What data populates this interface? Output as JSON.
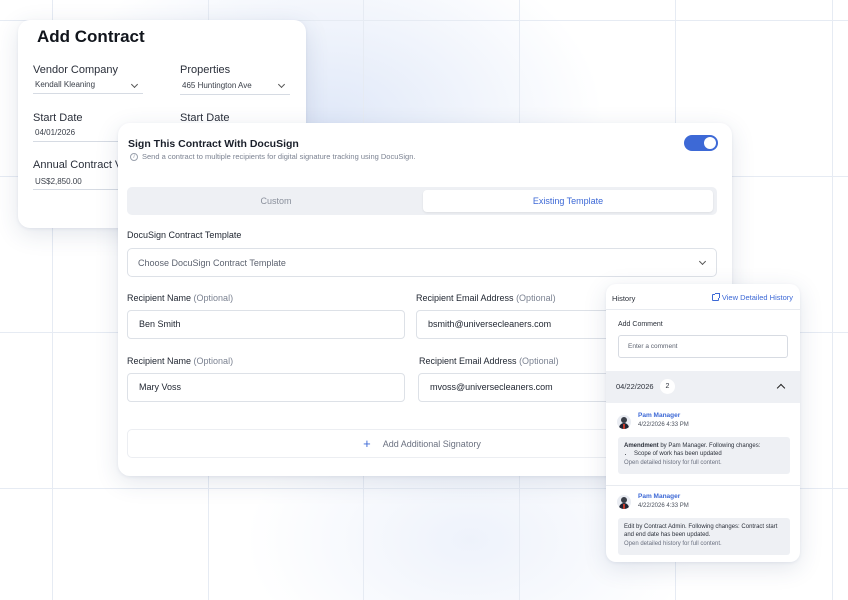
{
  "add_contract": {
    "title": "Add Contract",
    "vendor_label": "Vendor Company",
    "vendor_value": "Kendall Kleaning",
    "properties_label": "Properties",
    "properties_value": "465 Huntington Ave",
    "start_date_label_1": "Start Date",
    "start_date_value_1": "04/01/2026",
    "start_date_label_2": "Start Date",
    "annual_label": "Annual Contract V",
    "annual_value": "US$2,850.00"
  },
  "docusign": {
    "title": "Sign This Contract With DocuSign",
    "subtitle": "Send a contract to multiple recipients for digital signature tracking using DocuSign.",
    "info_icon": "i",
    "toggle_on": true,
    "tabs": [
      "Custom",
      "Existing Template"
    ],
    "active_tab": "Existing Template",
    "template_label": "DocuSign Contract Template",
    "template_placeholder": "Choose DocuSign Contract Template",
    "recipient_name_label": "Recipient Name",
    "recipient_email_label": "Recipient Email Address",
    "optional": "(Optional)",
    "recipients": [
      {
        "name": "Ben Smith",
        "email": "bsmith@universecleaners.com"
      },
      {
        "name": "Mary Voss",
        "email": "mvoss@universecleaners.com"
      }
    ],
    "add_signatory": "Add Additional Signatory",
    "plus": "+"
  },
  "history": {
    "title": "History",
    "view_link": "View Detailed History",
    "add_comment_label": "Add Comment",
    "comment_placeholder": "Enter a comment",
    "date": "04/22/2026",
    "count": "2",
    "entries": [
      {
        "author": "Pam Manager",
        "time": "4/22/2026 4:33 PM",
        "bold": "Amendment",
        "text": " by Pam Manager. Following changes:",
        "bullet": "Scope of work has been updated",
        "footer": "Open detailed history for full content."
      },
      {
        "author": "Pam Manager",
        "time": "4/22/2026 4:33 PM",
        "text": "Edit by Contract Admin. Following changes: Contract start and end date has been updated.",
        "footer": "Open detailed history for full content."
      }
    ]
  },
  "colors": {
    "accent": "#3d69d6",
    "grid": "#e6ebf3",
    "panel_gray": "#eef0f4"
  }
}
